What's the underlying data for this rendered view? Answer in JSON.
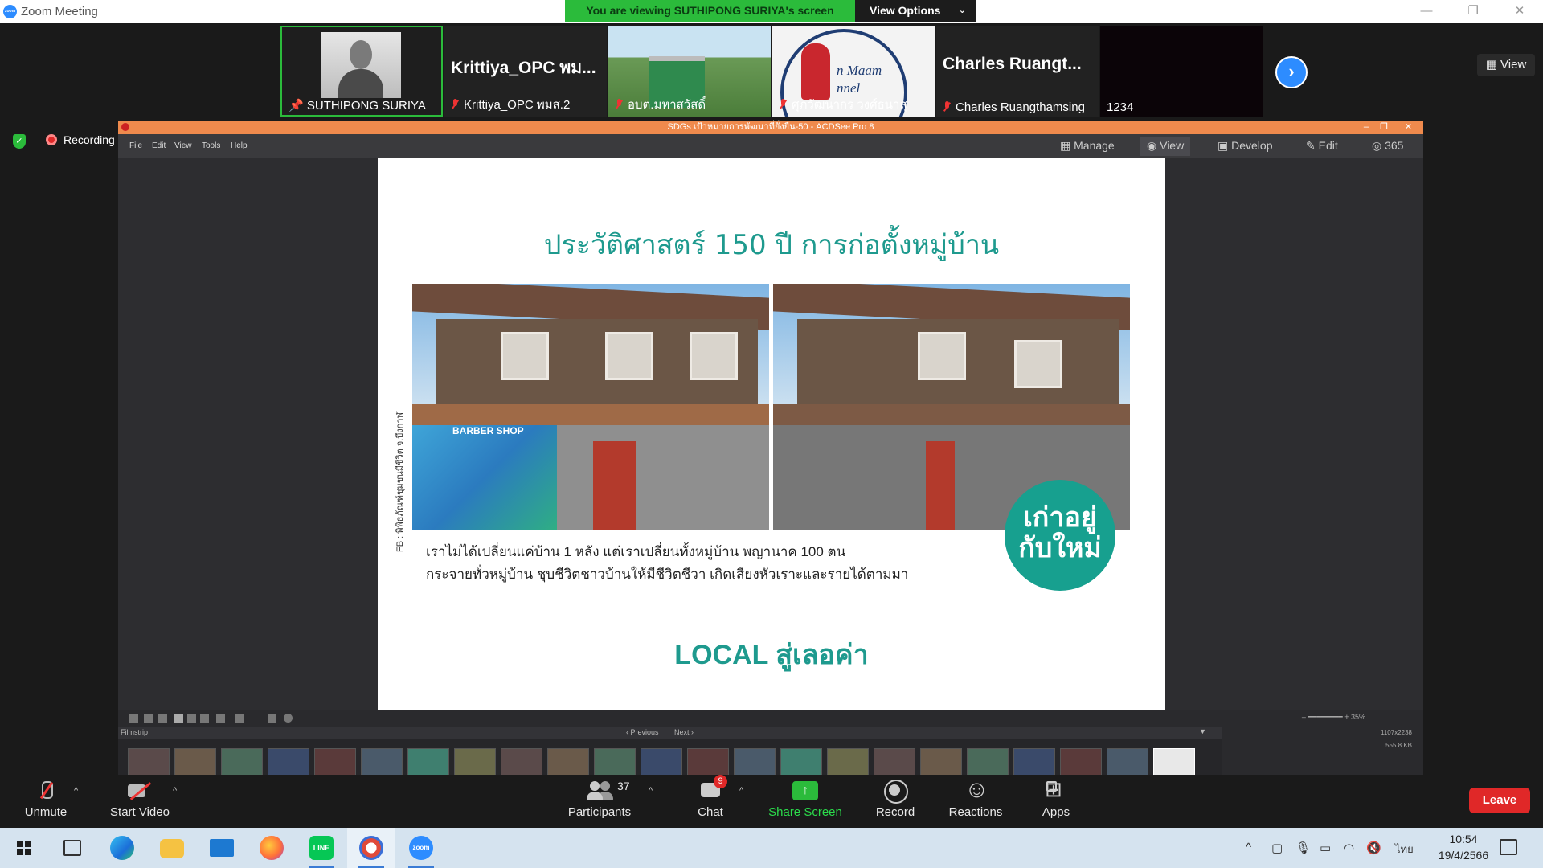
{
  "zoom": {
    "window_title": "Zoom Meeting",
    "window_controls": {
      "minimize": "—",
      "restore": "❐",
      "close": "✕"
    },
    "viewing_banner": "You are viewing SUTHIPONG SURIYA's screen",
    "view_options": "View Options",
    "view_button": "View",
    "recording": "Recording",
    "participants": [
      {
        "name": "SUTHIPONG SURIYA",
        "big_name": "",
        "type": "video",
        "pinned": true
      },
      {
        "name": "Krittiya_OPC พมส.2",
        "big_name": "Krittiya_OPC พม...",
        "type": "name"
      },
      {
        "name": "อบต.มหาสวัสดิ์",
        "big_name": "",
        "type": "video-building"
      },
      {
        "name": "ศุภวัฒนากร วงศ์ธนาสุ",
        "big_name": "",
        "type": "video-lady",
        "lady_text": "n Maam\nnnel"
      },
      {
        "name": "Charles Ruangthamsing",
        "big_name": "Charles Ruangt...",
        "type": "name"
      },
      {
        "name": "1234",
        "big_name": "",
        "type": "dark"
      }
    ],
    "controls": {
      "unmute": "Unmute",
      "start_video": "Start Video",
      "participants": "Participants",
      "participants_count": "37",
      "chat": "Chat",
      "chat_badge": "9",
      "share_screen": "Share Screen",
      "record": "Record",
      "reactions": "Reactions",
      "apps": "Apps",
      "leave": "Leave"
    }
  },
  "acdsee": {
    "title": "SDGs เป้าหมายการพัฒนาที่ยั่งยืน-50 - ACDSee Pro 8",
    "menu": [
      "File",
      "Edit",
      "View",
      "Tools",
      "Help"
    ],
    "modes": [
      "Manage",
      "View",
      "Develop",
      "Edit",
      "365"
    ],
    "active_mode": "View",
    "zoom_level": "35%",
    "filmstrip_label": "Filmstrip",
    "previous": "‹ Previous",
    "next": "Next ›",
    "info_dims": "1107x2238",
    "info_size": "555.8 KB",
    "slide": {
      "title": "ประวัติศาสตร์ 150 ปี การก่อตั้งหมู่บ้าน",
      "photo_credit": "FB : พิพิธภัณฑ์ชุมชนมีชีวิต จ.บึงกาฬ",
      "mural_sign": "BARBER SHOP",
      "body_line1": "เราไม่ได้เปลี่ยนแค่บ้าน 1 หลัง  แต่เราเปลี่ยนทั้งหมู่บ้าน พญานาค 100 ตน",
      "body_line2": "กระจายทั่วหมู่บ้าน ชุบชีวิตชาวบ้านให้มีชีวิตชีวา เกิดเสียงหัวเราะและรายได้ตามมา",
      "badge_line1": "เก่าอยู่",
      "badge_line2": "กับใหม่",
      "footer": "LOCAL สู่เลอค่า"
    }
  },
  "taskbar": {
    "apps": [
      "start-button",
      "task-view",
      "edge",
      "file-explorer",
      "mail",
      "firefox",
      "line",
      "acdsee",
      "zoom"
    ],
    "language": "ไทย",
    "time": "10:54",
    "date": "19/4/2566"
  }
}
